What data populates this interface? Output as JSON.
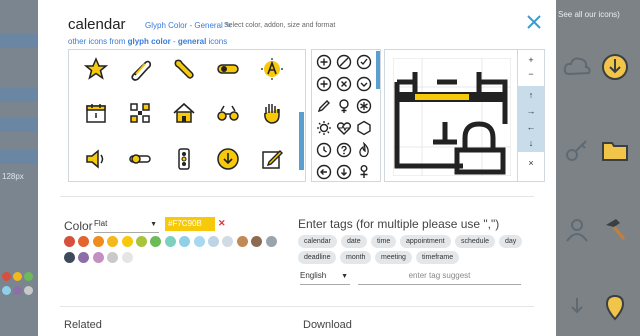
{
  "background": {
    "resolution_label": "128px",
    "see_all_link": "See all our icons)"
  },
  "modal": {
    "title": "calendar",
    "subtitle": "Glyph Color - General ✎",
    "instructions": "Select color, addon, size and format",
    "other_icons_prefix": "other icons from",
    "other_icons_style": "glyph color",
    "other_icons_sep": " - ",
    "other_icons_category": "general",
    "other_icons_suffix": " icons"
  },
  "icon_grid": {
    "items": [
      "star-icon",
      "paperclip-icon",
      "wrench-icon",
      "toggle-icon",
      "text-a-icon",
      "calendar-icon",
      "qr-icon",
      "home-icon",
      "binoculars-icon",
      "hand-icon",
      "speaker-icon",
      "switch-icon",
      "traffic-light-icon",
      "download-circle-icon",
      "edit-box-icon"
    ]
  },
  "glyph_grid": {
    "items": [
      "plus-circle-icon",
      "ban-icon",
      "check-circle-icon",
      "plus-circle-icon",
      "x-circle-icon",
      "down-circle-icon",
      "pencil-icon",
      "female-icon",
      "asterisk-icon",
      "sun-icon",
      "heart-pulse-icon",
      "hexagon-icon",
      "clock-icon",
      "question-circle-icon",
      "flame-icon",
      "arrow-circle-icon",
      "down-circle-icon",
      "user-icon"
    ]
  },
  "preview_controls": {
    "zoom_in": "+",
    "zoom_out": "−",
    "up": "↑",
    "right": "→",
    "left": "←",
    "down": "↓",
    "remove": "×"
  },
  "colors": {
    "accent": "#f7c90b",
    "link": "#3a7bd5",
    "scroll": "#5a9fd0"
  },
  "color_section": {
    "label": "Color",
    "style": "Flat",
    "hex": "#F7C90B",
    "swatches": [
      "#d7503c",
      "#e5632d",
      "#ef8c1f",
      "#f3b81b",
      "#f7c90b",
      "#a7c43b",
      "#6dbb57",
      "#7fcfc0",
      "#8fd0e6",
      "#a6d8f0",
      "#bcd4e6",
      "#d1dbe5",
      "#c08a54",
      "#8b6b52",
      "#9aa4ad",
      "#3e4a5c",
      "#8d6fa8",
      "#c48fc1",
      "#c9c9c9",
      "#e5e5e5"
    ]
  },
  "tags_section": {
    "title": "Enter tags (for multiple please use \",\")",
    "tags": [
      "calendar",
      "date",
      "time",
      "appointment",
      "schedule",
      "day",
      "deadline",
      "month",
      "meeting",
      "timeframe"
    ],
    "language": "English",
    "input_placeholder": "enter tag suggest"
  },
  "footer": {
    "related": "Related",
    "download": "Download"
  }
}
